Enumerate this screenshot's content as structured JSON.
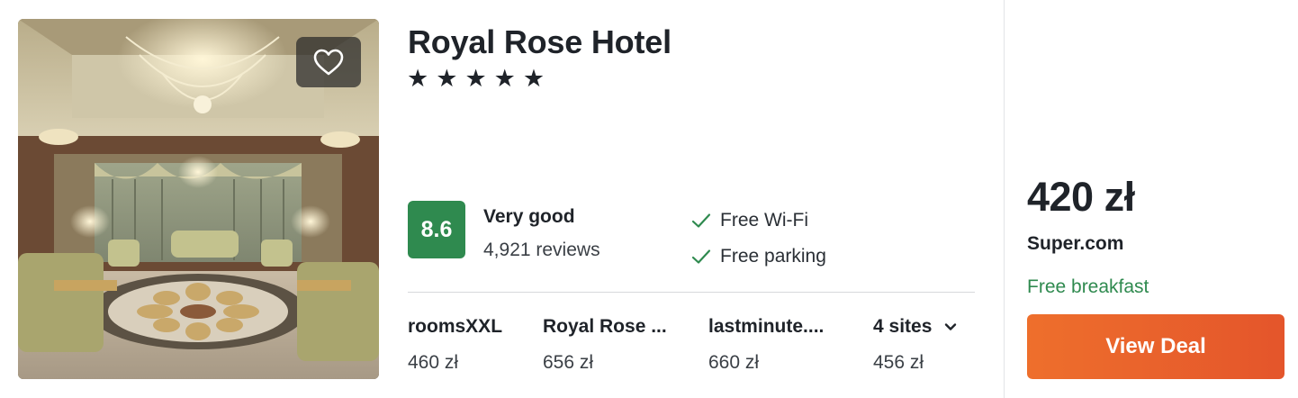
{
  "hotel": {
    "name": "Royal Rose Hotel",
    "star_count": 5,
    "stars": [
      "★",
      "★",
      "★",
      "★",
      "★"
    ],
    "image_alt": "Ornate hotel lobby with chandeliers"
  },
  "rating": {
    "score": "8.6",
    "label": "Very good",
    "reviews": "4,921 reviews"
  },
  "amenities": [
    "Free Wi-Fi",
    "Free parking"
  ],
  "sites": [
    {
      "name": "roomsXXL",
      "price": "460 zł"
    },
    {
      "name": "Royal Rose ...",
      "price": "656 zł"
    },
    {
      "name": "lastminute....",
      "price": "660 zł"
    },
    {
      "name": "4 sites",
      "price": "456 zł"
    }
  ],
  "deal": {
    "price": "420 zł",
    "provider": "Super.com",
    "perk": "Free breakfast",
    "button_label": "View Deal"
  },
  "icons": {
    "favorite": "heart-outline-icon",
    "amenity_check": "check-icon",
    "expand": "chevron-down-icon"
  },
  "colors": {
    "score_badge": "#2f8a4f",
    "perk_text": "#2f8a4f",
    "button_start": "#ee6f2c",
    "button_end": "#e4552b",
    "favorite_bg": "#282828"
  }
}
